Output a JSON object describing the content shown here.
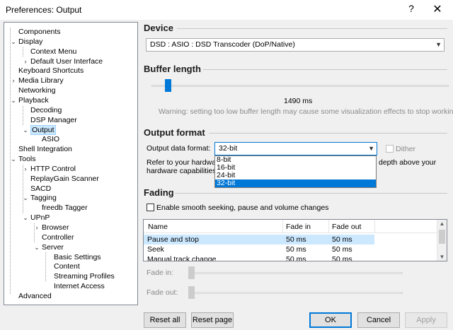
{
  "window": {
    "title": "Preferences: Output",
    "help_glyph": "?",
    "close_glyph": "✕"
  },
  "tree": {
    "items": [
      {
        "label": "Components",
        "twisty": ""
      },
      {
        "label": "Display",
        "twisty": "v"
      },
      {
        "label": "Context Menu",
        "twisty": ""
      },
      {
        "label": "Default User Interface",
        "twisty": ">"
      },
      {
        "label": "Keyboard Shortcuts",
        "twisty": ""
      },
      {
        "label": "Media Library",
        "twisty": ">"
      },
      {
        "label": "Networking",
        "twisty": ""
      },
      {
        "label": "Playback",
        "twisty": "v"
      },
      {
        "label": "Decoding",
        "twisty": ""
      },
      {
        "label": "DSP Manager",
        "twisty": ""
      },
      {
        "label": "Output",
        "twisty": "v"
      },
      {
        "label": "ASIO",
        "twisty": ""
      },
      {
        "label": "Shell Integration",
        "twisty": ""
      },
      {
        "label": "Tools",
        "twisty": "v"
      },
      {
        "label": "HTTP Control",
        "twisty": ">"
      },
      {
        "label": "ReplayGain Scanner",
        "twisty": ""
      },
      {
        "label": "SACD",
        "twisty": ""
      },
      {
        "label": "Tagging",
        "twisty": "v"
      },
      {
        "label": "freedb Tagger",
        "twisty": ""
      },
      {
        "label": "UPnP",
        "twisty": "v"
      },
      {
        "label": "Browser",
        "twisty": ">"
      },
      {
        "label": "Controller",
        "twisty": ""
      },
      {
        "label": "Server",
        "twisty": "v"
      },
      {
        "label": "Basic Settings",
        "twisty": ""
      },
      {
        "label": "Content",
        "twisty": ""
      },
      {
        "label": "Streaming Profiles",
        "twisty": ""
      },
      {
        "label": "Internet Access",
        "twisty": ""
      },
      {
        "label": "Advanced",
        "twisty": ""
      }
    ],
    "selected": "Output"
  },
  "device": {
    "heading": "Device",
    "value": "DSD : ASIO : DSD Transcoder (DoP/Native)"
  },
  "buffer": {
    "heading": "Buffer length",
    "value_text": "1490 ms",
    "slider_fraction": 0.05,
    "warning": "Warning: setting too low buffer length may cause some visualization effects to stop working."
  },
  "output_format": {
    "heading": "Output format",
    "label": "Output data format:",
    "selected": "32-bit",
    "options": [
      "8-bit",
      "16-bit",
      "24-bit",
      "32-bit"
    ],
    "dither_label": "Dither",
    "help_line1_left": "Refer to your hardware",
    "help_line1_right": "depth above your",
    "help_line2_left": "hardware capabilities w"
  },
  "fading": {
    "heading": "Fading",
    "checkbox_label": "Enable smooth seeking, pause and volume changes",
    "columns": [
      "Name",
      "Fade in",
      "Fade out"
    ],
    "rows": [
      {
        "name": "Pause and stop",
        "fade_in": "50 ms",
        "fade_out": "50 ms"
      },
      {
        "name": "Seek",
        "fade_in": "50 ms",
        "fade_out": "50 ms"
      },
      {
        "name": "Manual track change",
        "fade_in": "50 ms",
        "fade_out": "50 ms"
      }
    ],
    "fade_in_label": "Fade in:",
    "fade_out_label": "Fade out:"
  },
  "buttons": {
    "reset_all": "Reset all",
    "reset_page": "Reset page",
    "ok": "OK",
    "cancel": "Cancel",
    "apply": "Apply"
  },
  "colors": {
    "accent": "#0078d7",
    "selection": "#cce8ff"
  }
}
